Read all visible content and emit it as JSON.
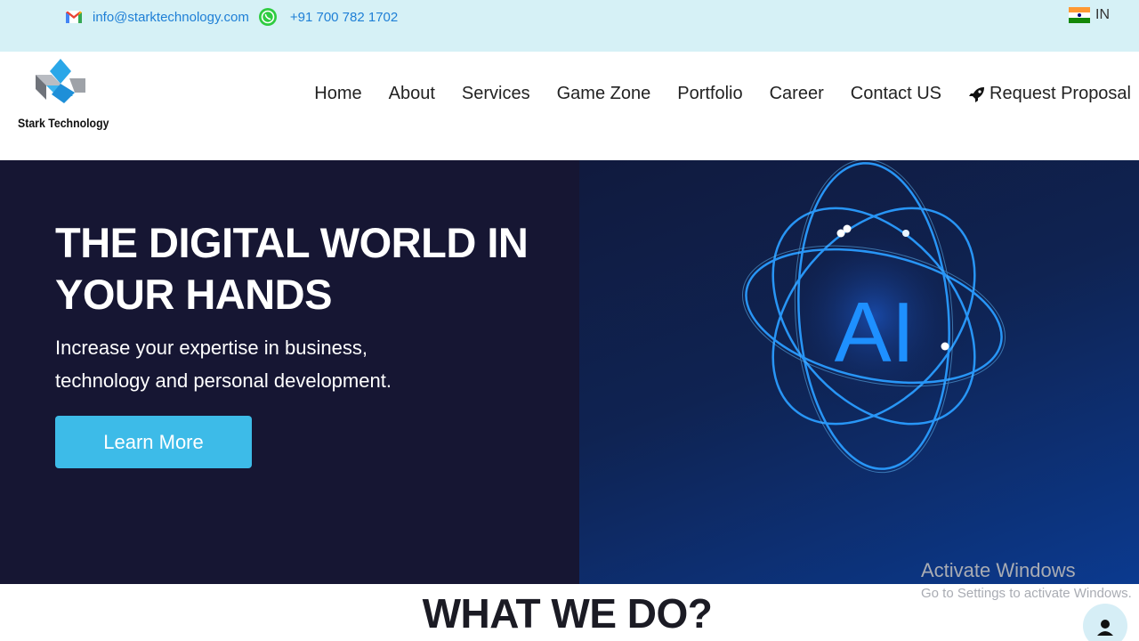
{
  "topbar": {
    "email": "info@starktechnology.com",
    "phone": "+91 700 782 1702",
    "language": "IN",
    "icons": {
      "mail": "gmail-icon",
      "whatsapp": "whatsapp-icon",
      "flag": "india-flag-icon"
    }
  },
  "header": {
    "logo_text": "Stark Technology",
    "nav": [
      {
        "label": "Home"
      },
      {
        "label": "About"
      },
      {
        "label": "Services"
      },
      {
        "label": "Game Zone"
      },
      {
        "label": "Portfolio"
      },
      {
        "label": "Career"
      },
      {
        "label": "Contact US"
      },
      {
        "label": "Request Proposal",
        "icon": "rocket-icon"
      }
    ]
  },
  "hero": {
    "title": "THE DIGITAL WORLD IN YOUR HANDS",
    "subtitle": "Increase your expertise in business, technology and personal development.",
    "button": "Learn More",
    "art_text": "AI"
  },
  "section": {
    "title": "WHAT WE DO?"
  },
  "watermark": {
    "line1": "Activate Windows",
    "line2": "Go to Settings to activate Windows."
  },
  "colors": {
    "topbar_bg": "#d6f1f6",
    "link": "#1e7fd6",
    "hero_bg": "#161633",
    "button": "#3dbbe8",
    "ai_glow": "#1e90ff"
  }
}
